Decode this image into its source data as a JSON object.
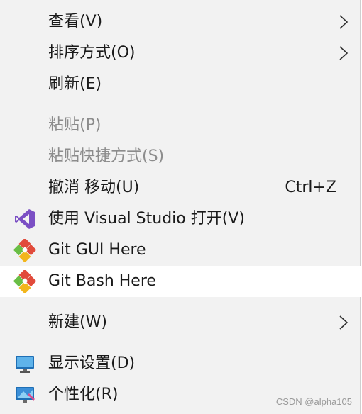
{
  "menu": {
    "items": [
      {
        "label": "查看(V)"
      },
      {
        "label": "排序方式(O)"
      },
      {
        "label": "刷新(E)"
      },
      {
        "label": "粘贴(P)"
      },
      {
        "label": "粘贴快捷方式(S)"
      },
      {
        "label": "撤消 移动(U)",
        "shortcut": "Ctrl+Z"
      },
      {
        "label": "使用 Visual Studio 打开(V)",
        "icon": "visual-studio-icon"
      },
      {
        "label": "Git GUI Here",
        "icon": "git-icon"
      },
      {
        "label": "Git Bash Here",
        "icon": "git-icon"
      },
      {
        "label": "新建(W)"
      },
      {
        "label": "显示设置(D)",
        "icon": "display-settings-icon"
      },
      {
        "label": "个性化(R)",
        "icon": "personalize-icon"
      }
    ]
  },
  "watermark": "CSDN @alpha105",
  "colors": {
    "menu_bg": "#f2f2f2",
    "hover_bg": "#ffffff",
    "disabled_text": "#8c8c8c",
    "vs_purple": "#7b4fc4",
    "git_red": "#e14b3b",
    "git_yellow": "#f2b61c",
    "git_green": "#6abe45",
    "monitor_blue": "#2f8fd6"
  }
}
